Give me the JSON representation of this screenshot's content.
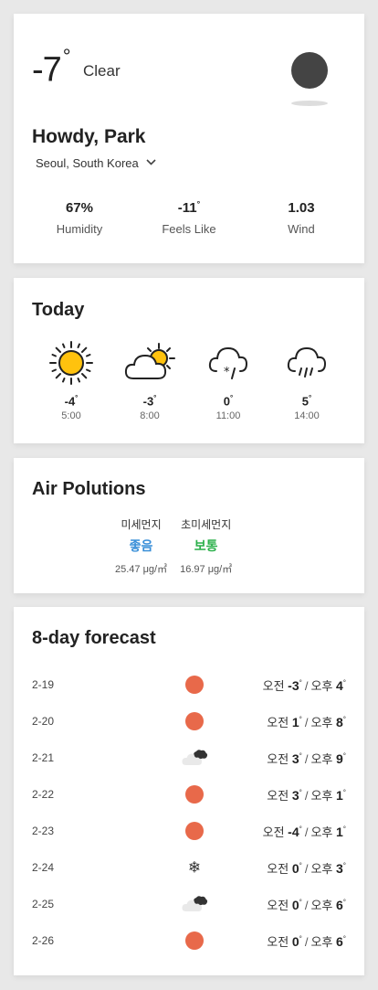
{
  "current": {
    "temp": "-7",
    "degree": "°",
    "condition": "Clear",
    "greeting": "Howdy, Park",
    "location": "Seoul, South Korea",
    "stats": [
      {
        "value": "67%",
        "unit": "",
        "label": "Humidity"
      },
      {
        "value": "-11",
        "unit": "°",
        "label": "Feels Like"
      },
      {
        "value": "1.03",
        "unit": "",
        "label": "Wind"
      }
    ]
  },
  "today": {
    "title": "Today",
    "hours": [
      {
        "icon": "sun-icon",
        "temp": "-4",
        "unit": "°",
        "time": "5:00"
      },
      {
        "icon": "partly-cloudy-icon",
        "temp": "-3",
        "unit": "°",
        "time": "8:00"
      },
      {
        "icon": "snow-cloud-icon",
        "temp": "0",
        "unit": "°",
        "time": "11:00"
      },
      {
        "icon": "rain-cloud-icon",
        "temp": "5",
        "unit": "°",
        "time": "14:00"
      }
    ]
  },
  "air": {
    "title": "Air Polutions",
    "items": [
      {
        "name": "미세먼지",
        "grade": "좋음",
        "grade_color": "#3a8fd8",
        "value": "25.47 μg/㎥"
      },
      {
        "name": "초미세먼지",
        "grade": "보통",
        "grade_color": "#2bb04a",
        "value": "16.97 μg/㎥"
      }
    ]
  },
  "forecast": {
    "title": "8-day forecast",
    "am_label": "오전",
    "pm_label": "오후",
    "separator": "/",
    "degree": "°",
    "days": [
      {
        "date": "2-19",
        "icon": "sun-icon",
        "am": "-3",
        "pm": "4"
      },
      {
        "date": "2-20",
        "icon": "sun-icon",
        "am": "1",
        "pm": "8"
      },
      {
        "date": "2-21",
        "icon": "cloudy-icon",
        "am": "3",
        "pm": "9"
      },
      {
        "date": "2-22",
        "icon": "sun-icon",
        "am": "3",
        "pm": "1"
      },
      {
        "date": "2-23",
        "icon": "sun-icon",
        "am": "-4",
        "pm": "1"
      },
      {
        "date": "2-24",
        "icon": "snowflake-icon",
        "am": "0",
        "pm": "3"
      },
      {
        "date": "2-25",
        "icon": "cloudy-icon",
        "am": "0",
        "pm": "6"
      },
      {
        "date": "2-26",
        "icon": "sun-icon",
        "am": "0",
        "pm": "6"
      }
    ]
  },
  "colors": {
    "sun_dot": "#e8694a",
    "sun_yellow": "#ffc20e",
    "moon": "#444444",
    "background": "#e8e8e8"
  }
}
